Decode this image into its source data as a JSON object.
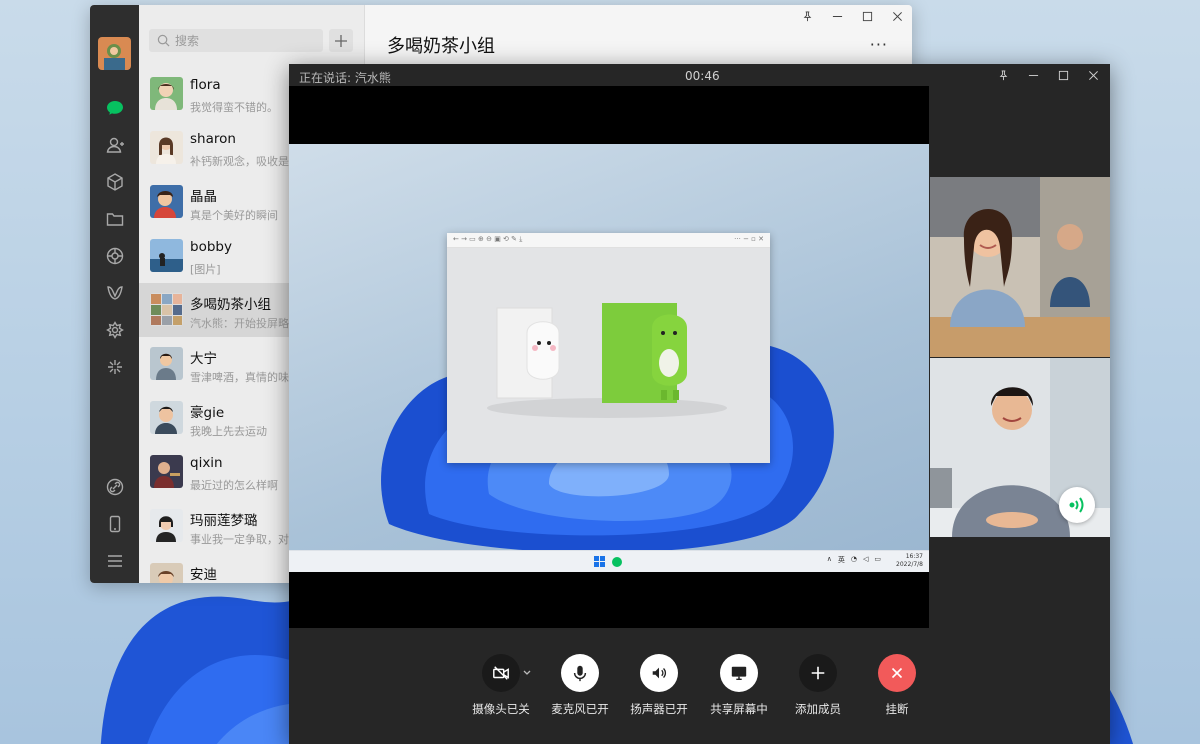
{
  "wechat": {
    "search_placeholder": "搜索",
    "chat_title": "多喝奶茶小组",
    "more_label": "···",
    "chats": [
      {
        "name": "flora",
        "preview": "我觉得蛮不错的。"
      },
      {
        "name": "sharon",
        "preview": "补钙新观念，吸收是"
      },
      {
        "name": "晶晶",
        "preview": "真是个美好的瞬间"
      },
      {
        "name": "bobby",
        "preview": "[图片]"
      },
      {
        "name": "多喝奶茶小组",
        "preview": "汽水熊：开始投屏略"
      },
      {
        "name": "大宁",
        "preview": "雪津啤酒，真情的味"
      },
      {
        "name": "豪gie",
        "preview": "我晚上先去运动"
      },
      {
        "name": "qixin",
        "preview": "最近过的怎么样啊"
      },
      {
        "name": "玛丽莲梦璐",
        "preview": "事业我一定争取，对"
      },
      {
        "name": "安迪",
        "preview": ""
      }
    ]
  },
  "call": {
    "status": "正在说话: 汽水熊",
    "timer": "00:46",
    "controls": {
      "camera": "摄像头已关",
      "mic": "麦克风已开",
      "speaker": "扬声器已开",
      "share": "共享屏幕中",
      "add": "添加成员",
      "hangup": "挂断"
    }
  },
  "shared_screen": {
    "tray_lang": "英",
    "time": "16:37",
    "date": "2022/7/8"
  },
  "colors": {
    "wechat_green": "#07c160",
    "hangup_red": "#f25a5a",
    "call_bg": "#262626",
    "nav_bg": "#2e2e2e"
  },
  "icons": [
    "search-icon",
    "plus-icon",
    "chat-icon",
    "contacts-icon",
    "box-icon",
    "folder-icon",
    "moments-icon",
    "channels-icon",
    "mini-program-icon",
    "search-spark-icon",
    "link-icon",
    "phone-icon",
    "menu-icon",
    "pin-icon",
    "minimize-icon",
    "maximize-icon",
    "close-icon",
    "camera-off-icon",
    "mic-icon",
    "speaker-icon",
    "screen-share-icon",
    "add-icon",
    "hangup-icon"
  ]
}
